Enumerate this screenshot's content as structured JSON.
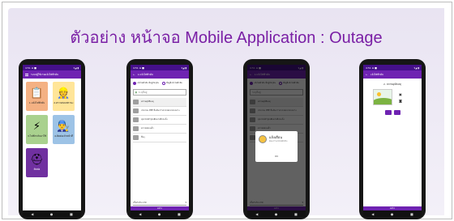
{
  "title": "ตัวอย่าง หน้าจอ Mobile Application : Outage",
  "colors": {
    "accent": "#6f23b2",
    "title": "#7a1fa5",
    "status_bar": "#45108a"
  },
  "status": {
    "left": "4:51 ⊡ ■",
    "right": "▾◢ ▮"
  },
  "phone1": {
    "appbar_title": "ระบบผู้ใช้งานแจ้งไฟฟ้าดับ",
    "tiles": [
      {
        "icon": "form-icon",
        "label": "1.แจ้งไฟฟ้าดับ",
        "color": "#f4b183"
      },
      {
        "icon": "worker-icon",
        "label": "2.ตรวจสอบสถานะ",
        "color": "#ffe599"
      },
      {
        "icon": "lightning-icon",
        "label": "3.ไฟฟ้ากลับมาใช้",
        "color": "#a9d18e"
      },
      {
        "icon": "engineer-icon",
        "label": "4.ติดต่อเจ้าหน้าที่",
        "color": "#9dc3e6"
      },
      {
        "icon": "helmet-icon",
        "label": "ติดต่อ",
        "color": "#7030a0"
      }
    ]
  },
  "phone2": {
    "appbar_title": "1.แจ้งไฟฟ้าดับ",
    "radio_a": "แจ้งไฟฟ้าดับ ที่อยู่ปัจจุบัน",
    "radio_b": "ที่อยู่ที่แจ้งไฟฟ้าดับ",
    "input_placeholder": "ระบุที่อยู่",
    "rows": [
      "สภาพอุบัติเหตุ",
      "ประกอบ PPE ยืนยันการตรวจสอบระยะทาง",
      "อุปกรณ์ชำรุดเสียหายที่จะแจ้ง",
      "ตรวจสอบแล้ว",
      "อื่นๆ"
    ],
    "select_label": "เลือกประเภท",
    "bottom_button": "ต่อไป"
  },
  "phone3": {
    "appbar_title": "1.แจ้งไฟฟ้าดับ",
    "dialog_title": "แจ้งเตือน",
    "dialog_sub": "ต้องการแจ้งไฟฟ้าดับ",
    "dialog_ok": "OK",
    "bottom_button": "ต่อไป"
  },
  "phone4": {
    "appbar_title": "แจ้งไฟฟ้าดับ",
    "section_label": "2. สภาพอุบัติเหตุ",
    "bottom_button": "ต่อไป"
  },
  "navbar": {
    "back": "◀",
    "home": "●",
    "recent": "■"
  }
}
